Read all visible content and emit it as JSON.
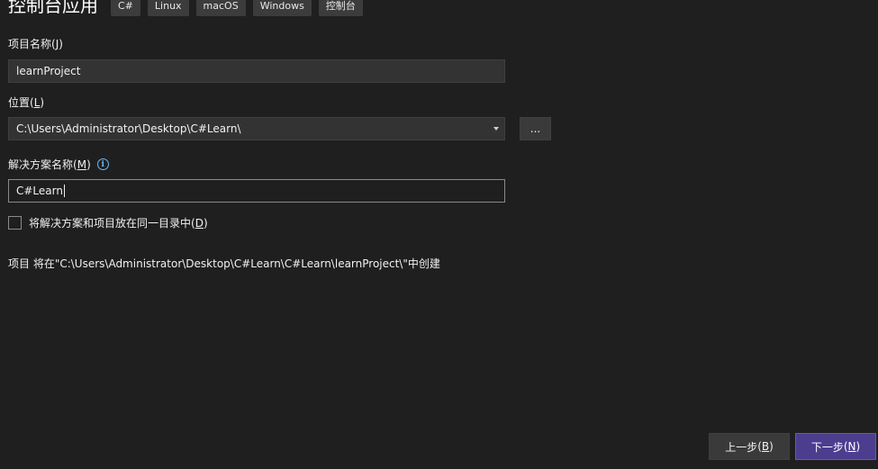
{
  "header": {
    "title": "控制台应用",
    "tags": [
      "C#",
      "Linux",
      "macOS",
      "Windows",
      "控制台"
    ]
  },
  "project_name": {
    "label": "项目名称",
    "accel": "J",
    "value": "learnProject"
  },
  "location": {
    "label": "位置",
    "accel": "L",
    "value": "C:\\Users\\Administrator\\Desktop\\C#Learn\\",
    "browse_label": "..."
  },
  "solution_name": {
    "label": "解决方案名称",
    "accel": "M",
    "info_icon": "info-icon",
    "value": "C#Learn"
  },
  "same_dir": {
    "label": "将解决方案和项目放在同一目录中",
    "accel": "D",
    "checked": false
  },
  "summary": "项目 将在\"C:\\Users\\Administrator\\Desktop\\C#Learn\\C#Learn\\learnProject\\\"中创建",
  "buttons": {
    "back_label": "上一步",
    "back_accel": "B",
    "next_label": "下一步",
    "next_accel": "N"
  },
  "colors": {
    "background": "#1f1f1f",
    "primary_button": "#4d3d8f",
    "info_accent": "#6cb8f6"
  }
}
